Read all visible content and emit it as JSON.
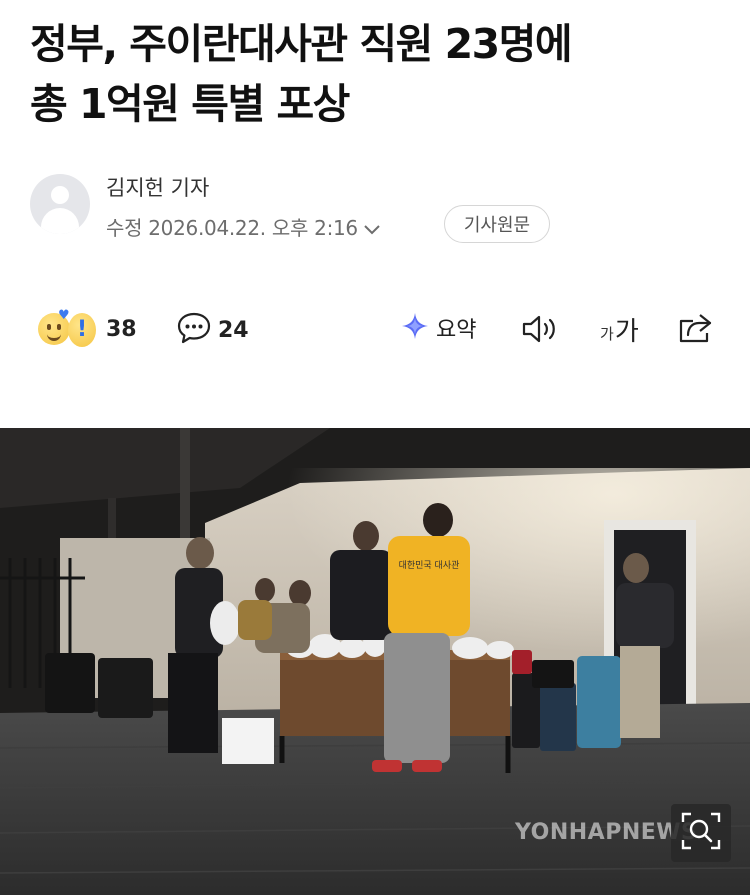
{
  "article": {
    "headline_line1": "정부, 주이란대사관 직원 23명에",
    "headline_line2": "총 1억원 특별 포상"
  },
  "byline": {
    "author": "김지헌 기자",
    "date": "수정 2026.04.22. 오후 2:16",
    "original_button": "기사원문"
  },
  "actions": {
    "reactions_count": "38",
    "comments_count": "24",
    "summary_label": "요약",
    "font_small": "가",
    "font_big": "가",
    "icons": [
      "reaction-emoji",
      "comment",
      "ai-summary",
      "speaker",
      "font-size",
      "share"
    ]
  },
  "photo": {
    "watermark": "YONHAPNEWS",
    "vest_text": "대한민국 대사관"
  },
  "colors": {
    "text": "#111111",
    "muted": "#6d6d6d",
    "summary_accent": "#5b6cf5",
    "vest": "#f0b324"
  }
}
